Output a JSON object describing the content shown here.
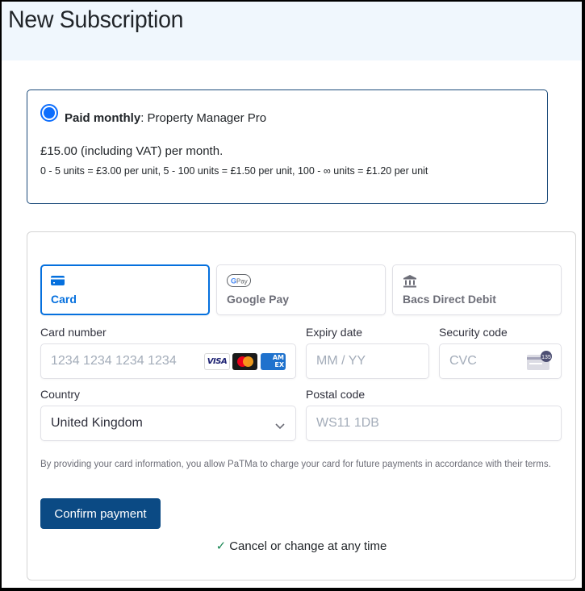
{
  "header": {
    "title": "New Subscription"
  },
  "plan": {
    "selected": true,
    "billing_label": "Paid monthly",
    "separator": ": ",
    "product_name": "Property Manager Pro",
    "price_text": "£15.00 (including VAT) per month.",
    "tiers_text": "0 - 5 units = £3.00 per unit, 5 - 100 units = £1.50 per unit, 100 - ∞ units = £1.20 per unit"
  },
  "payment": {
    "tabs": [
      {
        "label": "Card",
        "icon": "credit-card-icon",
        "active": true
      },
      {
        "label": "Google Pay",
        "icon": "google-pay-icon",
        "active": false,
        "icon_text": "G Pay"
      },
      {
        "label": "Bacs Direct Debit",
        "icon": "bank-icon",
        "active": false
      }
    ],
    "card_number": {
      "label": "Card number",
      "placeholder": "1234 1234 1234 1234",
      "value": "",
      "brands": [
        "VISA",
        "Mastercard",
        "AMEX"
      ]
    },
    "expiry": {
      "label": "Expiry date",
      "placeholder": "MM / YY",
      "value": ""
    },
    "security_code": {
      "label": "Security code",
      "placeholder": "CVC",
      "value": "",
      "icon_text": "135"
    },
    "country": {
      "label": "Country",
      "value": "United Kingdom"
    },
    "postal_code": {
      "label": "Postal code",
      "placeholder": "WS11 1DB",
      "value": ""
    },
    "disclaimer": "By providing your card information, you allow PaTMa to charge your card for future payments in accordance with their terms.",
    "confirm_label": "Confirm payment",
    "cancel_note_check": "✓",
    "cancel_note": "Cancel or change at any time"
  },
  "colors": {
    "accent": "#0570de",
    "button": "#0b4a84",
    "radio": "#0d6efd",
    "check": "#198754",
    "header_bg": "#f0f7fd"
  }
}
